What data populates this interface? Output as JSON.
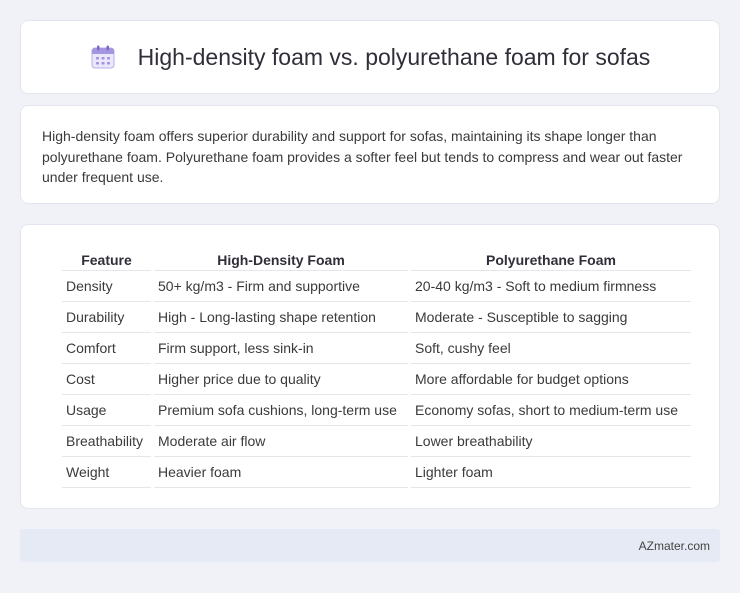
{
  "header": {
    "icon": "calendar-icon",
    "title": "High-density foam vs. polyurethane foam for sofas"
  },
  "summary": {
    "text": "High-density foam offers superior durability and support for sofas, maintaining its shape longer than polyurethane foam. Polyurethane foam provides a softer feel but tends to compress and wear out faster under frequent use."
  },
  "table": {
    "headers": [
      "Feature",
      "High-Density Foam",
      "Polyurethane Foam"
    ],
    "rows": [
      [
        "Density",
        "50+ kg/m3 - Firm and supportive",
        "20-40 kg/m3 - Soft to medium firmness"
      ],
      [
        "Durability",
        "High - Long-lasting shape retention",
        "Moderate - Susceptible to sagging"
      ],
      [
        "Comfort",
        "Firm support, less sink-in",
        "Soft, cushy feel"
      ],
      [
        "Cost",
        "Higher price due to quality",
        "More affordable for budget options"
      ],
      [
        "Usage",
        "Premium sofa cushions, long-term use",
        "Economy sofas, short to medium-term use"
      ],
      [
        "Breathability",
        "Moderate air flow",
        "Lower breathability"
      ],
      [
        "Weight",
        "Heavier foam",
        "Lighter foam"
      ]
    ]
  },
  "footer": {
    "text": "AZmater.com"
  },
  "colors": {
    "background": "#f0f2f7",
    "card": "#ffffff",
    "footer": "#e6eaf5",
    "icon_accent": "#9b8ad8"
  }
}
